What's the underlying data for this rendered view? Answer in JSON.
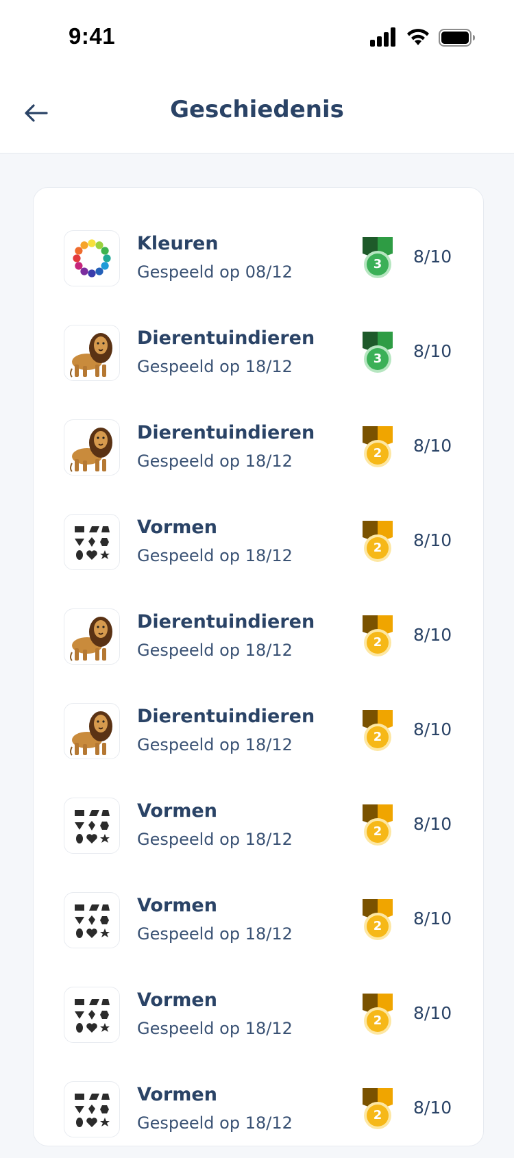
{
  "status_bar": {
    "time": "9:41"
  },
  "header": {
    "title": "Geschiedenis"
  },
  "colors": {
    "text": "#2a4366",
    "medal_green_ribbon": "#2e9c44",
    "medal_green": "#3bb057",
    "medal_gold_ribbon": "#f0a500",
    "medal_gold": "#f6b818"
  },
  "history": [
    {
      "title": "Kleuren",
      "subtitle": "Gespeeld op 08/12",
      "medal": "3",
      "medal_color": "green",
      "score": "8/10",
      "icon": "color-wheel-icon"
    },
    {
      "title": "Dierentuindieren",
      "subtitle": "Gespeeld op 18/12",
      "medal": "3",
      "medal_color": "green",
      "score": "8/10",
      "icon": "lion-icon"
    },
    {
      "title": "Dierentuindieren",
      "subtitle": "Gespeeld op 18/12",
      "medal": "2",
      "medal_color": "gold",
      "score": "8/10",
      "icon": "lion-icon"
    },
    {
      "title": "Vormen",
      "subtitle": "Gespeeld op 18/12",
      "medal": "2",
      "medal_color": "gold",
      "score": "8/10",
      "icon": "shapes-icon"
    },
    {
      "title": "Dierentuindieren",
      "subtitle": "Gespeeld op 18/12",
      "medal": "2",
      "medal_color": "gold",
      "score": "8/10",
      "icon": "lion-icon"
    },
    {
      "title": "Dierentuindieren",
      "subtitle": "Gespeeld op 18/12",
      "medal": "2",
      "medal_color": "gold",
      "score": "8/10",
      "icon": "lion-icon"
    },
    {
      "title": "Vormen",
      "subtitle": "Gespeeld op 18/12",
      "medal": "2",
      "medal_color": "gold",
      "score": "8/10",
      "icon": "shapes-icon"
    },
    {
      "title": "Vormen",
      "subtitle": "Gespeeld op 18/12",
      "medal": "2",
      "medal_color": "gold",
      "score": "8/10",
      "icon": "shapes-icon"
    },
    {
      "title": "Vormen",
      "subtitle": "Gespeeld op 18/12",
      "medal": "2",
      "medal_color": "gold",
      "score": "8/10",
      "icon": "shapes-icon"
    },
    {
      "title": "Vormen",
      "subtitle": "Gespeeld op 18/12",
      "medal": "2",
      "medal_color": "gold",
      "score": "8/10",
      "icon": "shapes-icon"
    }
  ]
}
